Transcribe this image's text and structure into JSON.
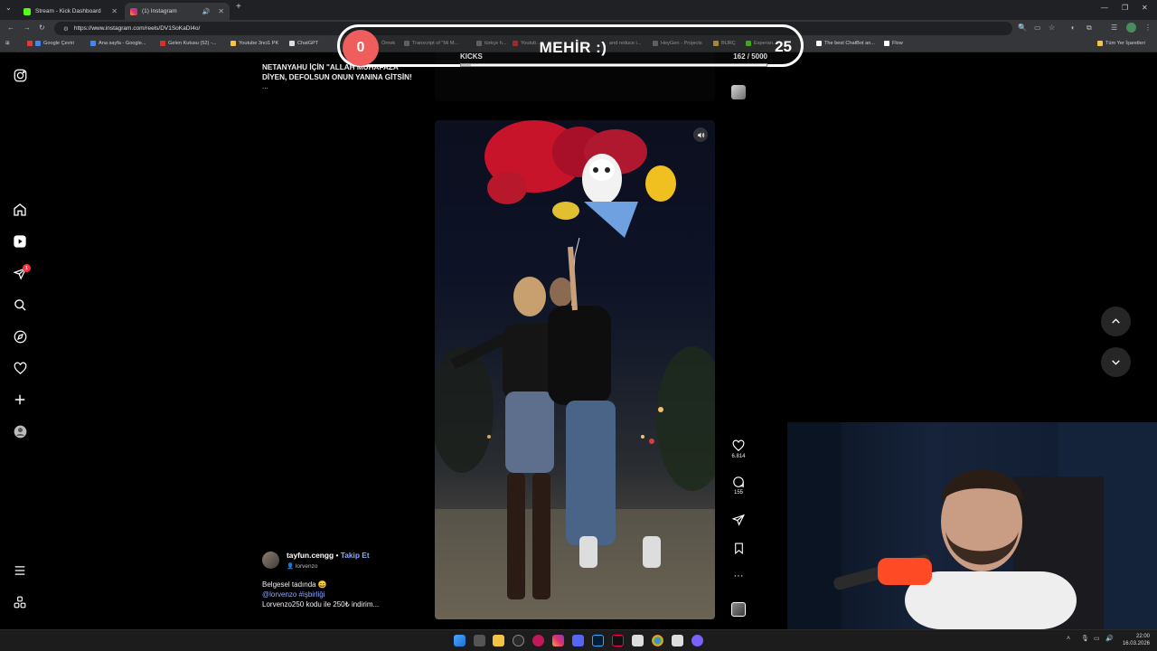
{
  "browser": {
    "tabs": [
      {
        "title": "Stream - Kick Dashboard",
        "active": false
      },
      {
        "title": "(1) Instagram",
        "active": true
      }
    ],
    "url": "https://www.instagram.com/reels/DV1SoKaDI4o/",
    "bookmarks": [
      "Google Çeviri",
      "Ana sayfa - Google...",
      "Gelen Kutusu (52) -...",
      "Youtube 3nci1 PK",
      "ChatGPT",
      "Örnek",
      "Transcript of \"Mi M...",
      "türkçe h...",
      "Youtub...",
      "and reduce i...",
      "HeyGen - Projects",
      "BURÇ",
      "Esperan...",
      "The best ChatBot an...",
      "Flow",
      "Tüm Yer İşaretleri"
    ]
  },
  "kick_widget": {
    "left_value": "0",
    "title": "MEHİR :)",
    "right_value": "25",
    "label": "KICKS",
    "progress_text": "162  / 5000",
    "progress_fraction": 0.032
  },
  "instagram": {
    "sidebar_icons": [
      "instagram-logo-icon",
      "home-icon",
      "reels-icon",
      "send-icon",
      "search-icon",
      "explore-icon",
      "heart-icon",
      "create-icon",
      "profile-icon",
      "menu-icon",
      "also-from-meta-icon"
    ],
    "notification_badge": "1",
    "previous_post": {
      "caption": "NETANYAHU İÇİN \"ALLAH MUHAFAZA\" DİYEN, DEFOLSUN ONUN YANINA GİTSİN!",
      "more": "..."
    },
    "reel": {
      "username": "tayfun.cengg",
      "separator": "•",
      "follow_label": "Takip Et",
      "audio": "lorvenzo",
      "caption_line1": "Belgesel tadında 😄",
      "mention": "@lorvenzo",
      "hashtag": "#işbirliği",
      "caption_line3": "Lorvenzo250 kodu ile 250₺ indirim...",
      "likes": "6.814",
      "comments": "155"
    }
  },
  "taskbar": {
    "time": "22:00",
    "date": "16.03.2026"
  },
  "colors": {
    "kick_green": "#53fc18",
    "instagram_link": "#8ba9ff",
    "kick_circle": "#ef5d5d"
  }
}
